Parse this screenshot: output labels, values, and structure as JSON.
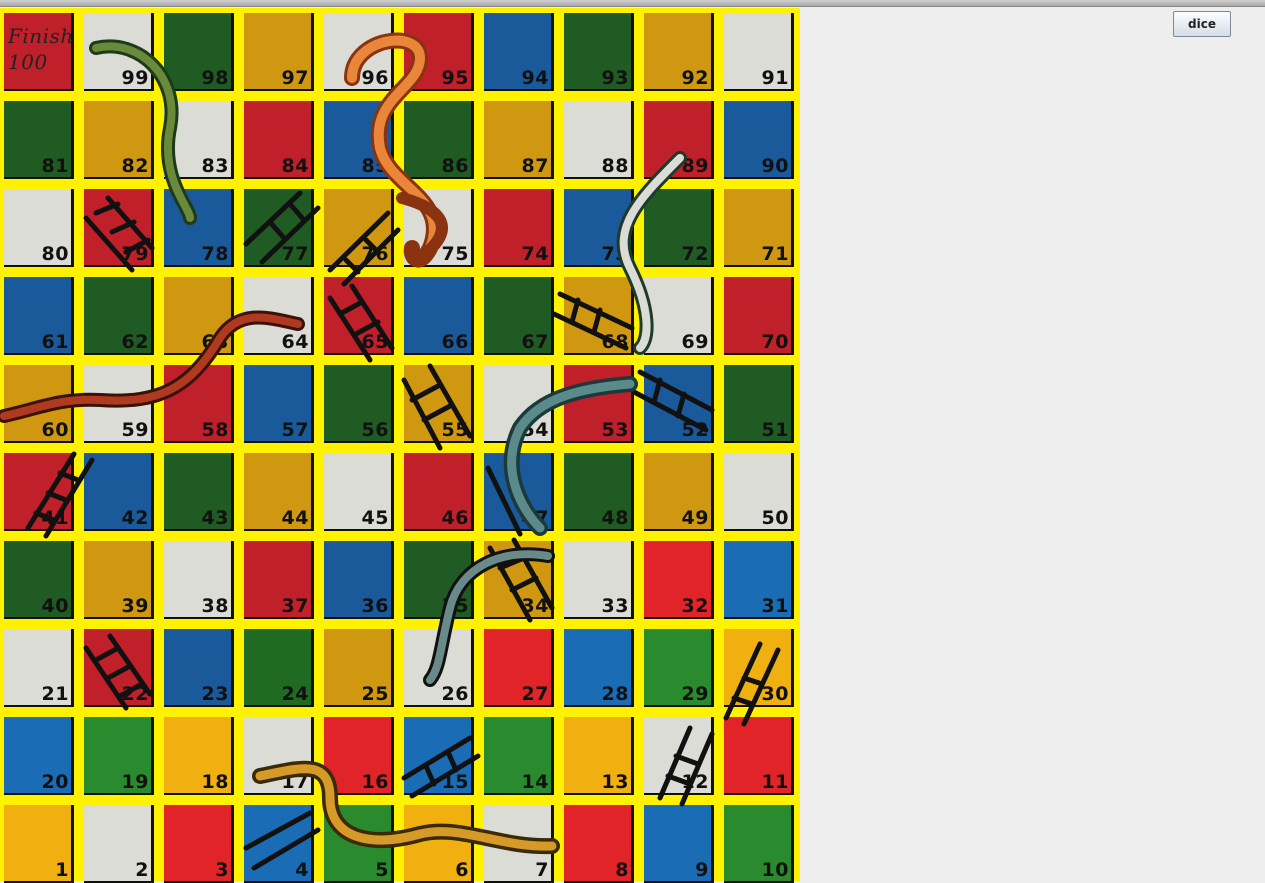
{
  "window": {
    "title": ""
  },
  "controls": {
    "dice_label": "dice"
  },
  "board": {
    "rows": [
      [
        {
          "n": "100",
          "label": "Finish 100",
          "color": "#c0202a"
        },
        {
          "n": "99",
          "color": "#dcdcd6"
        },
        {
          "n": "98",
          "color": "#1f5b22"
        },
        {
          "n": "97",
          "color": "#d09810"
        },
        {
          "n": "96",
          "color": "#dcdcd6"
        },
        {
          "n": "95",
          "color": "#c0202a"
        },
        {
          "n": "94",
          "color": "#1a5a9a"
        },
        {
          "n": "93",
          "color": "#1f5b22"
        },
        {
          "n": "92",
          "color": "#d09810"
        },
        {
          "n": "91",
          "color": "#dcdcd6"
        }
      ],
      [
        {
          "n": "81",
          "color": "#1f5b22"
        },
        {
          "n": "82",
          "color": "#d09810"
        },
        {
          "n": "83",
          "color": "#dcdcd6"
        },
        {
          "n": "84",
          "color": "#c0202a"
        },
        {
          "n": "85",
          "color": "#1a5a9a"
        },
        {
          "n": "86",
          "color": "#1f5b22"
        },
        {
          "n": "87",
          "color": "#d09810"
        },
        {
          "n": "88",
          "color": "#dcdcd6"
        },
        {
          "n": "89",
          "color": "#c0202a"
        },
        {
          "n": "90",
          "color": "#1a5a9a"
        }
      ],
      [
        {
          "n": "80",
          "color": "#dcdcd6"
        },
        {
          "n": "79",
          "color": "#c0202a"
        },
        {
          "n": "78",
          "color": "#1a5a9a"
        },
        {
          "n": "77",
          "color": "#1f5b22"
        },
        {
          "n": "76",
          "color": "#d09810"
        },
        {
          "n": "75",
          "color": "#dcdcd6"
        },
        {
          "n": "74",
          "color": "#c0202a"
        },
        {
          "n": "73",
          "color": "#1a5a9a"
        },
        {
          "n": "72",
          "color": "#1f5b22"
        },
        {
          "n": "71",
          "color": "#d09810"
        }
      ],
      [
        {
          "n": "61",
          "color": "#1a5a9a"
        },
        {
          "n": "62",
          "color": "#1f5b22"
        },
        {
          "n": "63",
          "color": "#d09810"
        },
        {
          "n": "64",
          "color": "#dcdcd6"
        },
        {
          "n": "65",
          "color": "#c0202a"
        },
        {
          "n": "66",
          "color": "#1a5a9a"
        },
        {
          "n": "67",
          "color": "#1f5b22"
        },
        {
          "n": "68",
          "color": "#d09810"
        },
        {
          "n": "69",
          "color": "#dcdcd6"
        },
        {
          "n": "70",
          "color": "#c0202a"
        }
      ],
      [
        {
          "n": "60",
          "color": "#d09810"
        },
        {
          "n": "59",
          "color": "#dcdcd6"
        },
        {
          "n": "58",
          "color": "#c0202a"
        },
        {
          "n": "57",
          "color": "#1a5a9a"
        },
        {
          "n": "56",
          "color": "#1f5b22"
        },
        {
          "n": "55",
          "color": "#d09810"
        },
        {
          "n": "54",
          "color": "#dcdcd6"
        },
        {
          "n": "53",
          "color": "#c0202a"
        },
        {
          "n": "52",
          "color": "#1a5a9a"
        },
        {
          "n": "51",
          "color": "#1f5b22"
        }
      ],
      [
        {
          "n": "41",
          "color": "#c0202a"
        },
        {
          "n": "42",
          "color": "#1a5a9a"
        },
        {
          "n": "43",
          "color": "#1f5b22"
        },
        {
          "n": "44",
          "color": "#d09810"
        },
        {
          "n": "45",
          "color": "#dcdcd6"
        },
        {
          "n": "46",
          "color": "#c0202a"
        },
        {
          "n": "47",
          "color": "#1a5a9a"
        },
        {
          "n": "48",
          "color": "#1f5b22"
        },
        {
          "n": "49",
          "color": "#d09810"
        },
        {
          "n": "50",
          "color": "#dcdcd6"
        }
      ],
      [
        {
          "n": "40",
          "color": "#1f5b22"
        },
        {
          "n": "39",
          "color": "#d09810"
        },
        {
          "n": "38",
          "color": "#dcdcd6"
        },
        {
          "n": "37",
          "color": "#c0202a"
        },
        {
          "n": "36",
          "color": "#1a5a9a"
        },
        {
          "n": "35",
          "color": "#1f5b22"
        },
        {
          "n": "34",
          "color": "#d09810"
        },
        {
          "n": "33",
          "color": "#dcdcd6"
        },
        {
          "n": "32",
          "color": "#e02428"
        },
        {
          "n": "31",
          "color": "#1a6cb4"
        }
      ],
      [
        {
          "n": "21",
          "color": "#dcdcd6"
        },
        {
          "n": "22",
          "color": "#c0202a"
        },
        {
          "n": "23",
          "color": "#1a5a9a"
        },
        {
          "n": "24",
          "color": "#1f6b22"
        },
        {
          "n": "25",
          "color": "#d09810"
        },
        {
          "n": "26",
          "color": "#dcdcd6"
        },
        {
          "n": "27",
          "color": "#e02428"
        },
        {
          "n": "28",
          "color": "#1a6cb4"
        },
        {
          "n": "29",
          "color": "#2a8a2e"
        },
        {
          "n": "30",
          "color": "#f0b010"
        }
      ],
      [
        {
          "n": "20",
          "color": "#1a6cb4"
        },
        {
          "n": "19",
          "color": "#2a8a2e"
        },
        {
          "n": "18",
          "color": "#f0b010"
        },
        {
          "n": "17",
          "color": "#dcdcd6"
        },
        {
          "n": "16",
          "color": "#e02428"
        },
        {
          "n": "15",
          "color": "#1a6cb4"
        },
        {
          "n": "14",
          "color": "#2a8a2e"
        },
        {
          "n": "13",
          "color": "#f0b010"
        },
        {
          "n": "12",
          "color": "#dcdcd6"
        },
        {
          "n": "11",
          "color": "#e02428"
        }
      ],
      [
        {
          "n": "1",
          "color": "#f0b010"
        },
        {
          "n": "2",
          "color": "#dcdcd6"
        },
        {
          "n": "3",
          "color": "#e02428"
        },
        {
          "n": "4",
          "color": "#1a6cb4"
        },
        {
          "n": "5",
          "color": "#2a8a2e"
        },
        {
          "n": "6",
          "color": "#f0b010"
        },
        {
          "n": "7",
          "color": "#dcdcd6"
        },
        {
          "n": "8",
          "color": "#e02428"
        },
        {
          "n": "9",
          "color": "#1a6cb4"
        },
        {
          "n": "10",
          "color": "#2a8a2e"
        }
      ]
    ]
  }
}
